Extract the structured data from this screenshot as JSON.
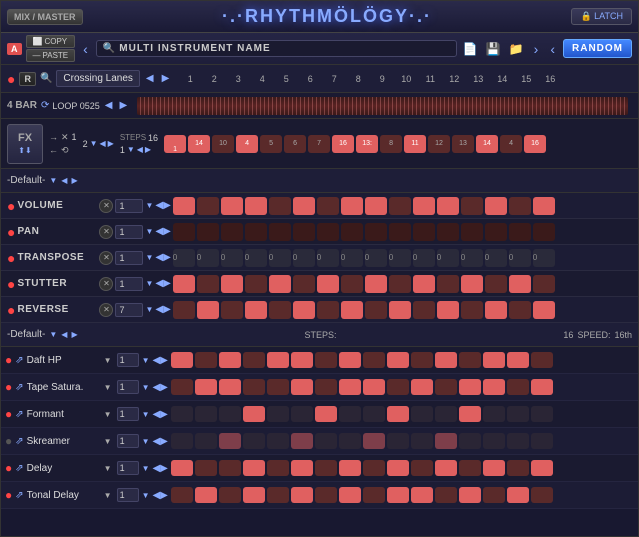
{
  "topBar": {
    "mixMaster": "MIX / MASTER",
    "title": "·.·RHYTHMÖLÖGY·.·",
    "latch": "LATCH"
  },
  "secondBar": {
    "aBadge": "A",
    "copy": "COPY",
    "paste": "PASTE",
    "navLeft": "‹",
    "navRight": "›",
    "searchIcon": "🔍",
    "instrumentName": "MULTI INSTRUMENT NAME",
    "navLeft2": "‹",
    "navRight2": "›",
    "random": "RANDOM"
  },
  "thirdBar": {
    "rBadge": "R",
    "laneName": "Crossing Lanes",
    "steps": [
      "1",
      "2",
      "3",
      "4",
      "5",
      "6",
      "7",
      "8",
      "9",
      "10",
      "11",
      "12",
      "13",
      "14",
      "15",
      "16"
    ]
  },
  "loopBar": {
    "barLabel": "4 BAR",
    "loopName": "LOOP 0525"
  },
  "fxBar": {
    "label": "FX",
    "stepVal1": "1",
    "stepNum": "2",
    "stepsLabel": "STEPS",
    "stepsVal": "16",
    "rowVal": "1",
    "stepNums": [
      "1",
      "14",
      "10",
      "4",
      "5",
      "6",
      "7",
      "16",
      "13+",
      "8",
      "11",
      "12",
      "13",
      "14",
      "4",
      "16"
    ]
  },
  "defaultSection1": {
    "label": "-Default-"
  },
  "volumeRow": {
    "label": "VOLUME",
    "val": "1"
  },
  "panRow": {
    "label": "PAN",
    "val": "1"
  },
  "transposeRow": {
    "label": "TRANSPOSE",
    "val": "1",
    "cells": [
      "0",
      "0",
      "0",
      "0",
      "0",
      "0",
      "0",
      "0",
      "0",
      "0",
      "0",
      "0",
      "0",
      "0",
      "0",
      "0"
    ]
  },
  "stutterRow": {
    "label": "STUTTER",
    "val": "1"
  },
  "reverseRow": {
    "label": "REVERSE",
    "val": "7"
  },
  "defaultSection2": {
    "label": "-Default-",
    "stepsLabel": "STEPS:",
    "stepsVal": "16",
    "speedLabel": "SPEED:",
    "speedVal": "16th"
  },
  "instruments": [
    {
      "name": "Daft HP",
      "val": "1",
      "active": true
    },
    {
      "name": "Tape Satura.",
      "val": "1",
      "active": true
    },
    {
      "name": "Formant",
      "val": "1",
      "active": true
    },
    {
      "name": "Skreamer",
      "val": "1",
      "active": false
    },
    {
      "name": "Delay",
      "val": "1",
      "active": true
    },
    {
      "name": "Tonal Delay",
      "val": "1",
      "active": true
    }
  ]
}
